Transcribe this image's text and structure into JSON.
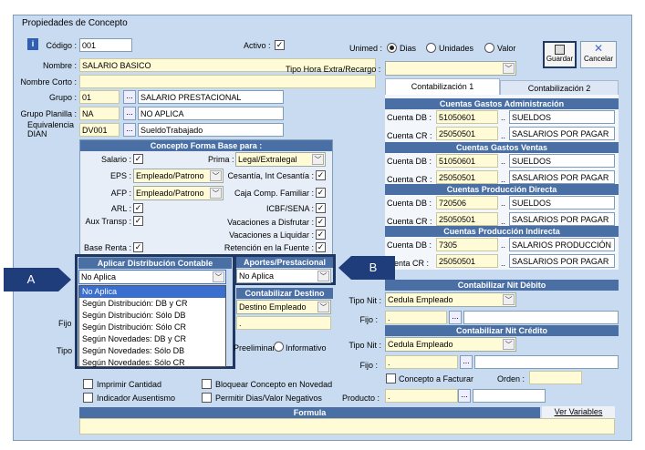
{
  "window": {
    "title": "Propiedades de Concepto"
  },
  "fields": {
    "codigo_label": "Código :",
    "codigo": "001",
    "activo_label": "Activo :",
    "nombre_label": "Nombre :",
    "nombre": "SALARIO BASICO",
    "nombre_corto_label": "Nombre Corto :",
    "grupo_label": "Grupo :",
    "grupo": "01",
    "grupo_desc": "SALARIO PRESTACIONAL",
    "grupo_planilla_label": "Grupo Planilla :",
    "grupo_planilla": "NA",
    "grupo_planilla_desc": "NO APLICA",
    "equivalencia_label": "Equivalencia\nDIAN",
    "equivalencia": "DV001",
    "equivalencia_desc": "SueldoTrabajado",
    "unimed_label": "Unimed :",
    "unimed_options": [
      "Dias",
      "Unidades",
      "Valor"
    ],
    "tipo_hora_label": "Tipo Hora Extra/Recargo :"
  },
  "toolbar": {
    "guardar": "Guardar",
    "cancelar": "Cancelar"
  },
  "forma_base": {
    "header": "Concepto Forma Base para :",
    "salario": "Salario :",
    "prima": "Prima :",
    "prima_value": "Legal/Extralegal",
    "eps": "EPS :",
    "eps_value": "Empleado/Patrono",
    "cesantia": "Cesantía, Int Cesantía :",
    "afp": "AFP :",
    "afp_value": "Empleado/Patrono",
    "caja": "Caja Comp. Familiar :",
    "arl": "ARL :",
    "icbf": "ICBF/SENA :",
    "aux": "Aux Transp :",
    "vac_disfrutar": "Vacaciones a Disfrutar :",
    "vac_liquidar": "Vacaciones a Liquidar :",
    "base_renta": "Base Renta :",
    "retencion": "Retención en la Fuente :"
  },
  "distribucion": {
    "header": "Aplicar Distribución Contable",
    "value": "No Aplica",
    "options": [
      "No Aplica",
      "Según Distribución: DB y CR",
      "Según Distribución: Sólo DB",
      "Según Distribución: Sólo CR",
      "Según Novedades: DB y CR",
      "Según Novedades: Sólo DB",
      "Según Novedades: Sólo CR"
    ]
  },
  "aportes": {
    "header": "Aportes/Prestacional",
    "value": "No Aplica"
  },
  "destino": {
    "header": "Contabilizar Destino",
    "value": "Destino Empleado",
    "fijo_label": "Fijo",
    "tipo_label": "Tipo",
    "preliminar": "Preeliminar",
    "informativo": "Informativo"
  },
  "tabs": [
    "Contabilización 1",
    "Contabilización 2"
  ],
  "cuentas": [
    {
      "header": "Cuentas Gastos Administración",
      "db": "51050601",
      "db_desc": "SUELDOS",
      "cr": "25050501",
      "cr_desc": "SASLARIOS POR PAGAR"
    },
    {
      "header": "Cuentas Gastos Ventas",
      "db": "51050601",
      "db_desc": "SUELDOS",
      "cr": "25050501",
      "cr_desc": "SASLARIOS POR PAGAR"
    },
    {
      "header": "Cuentas Producción Directa",
      "db": "720506",
      "db_desc": "SUELDOS",
      "cr": "25050501",
      "cr_desc": "SASLARIOS POR PAGAR"
    },
    {
      "header": "Cuentas Producción Indirecta",
      "db": "7305",
      "db_desc": "SALARIOS PRODUCCIÓN IN",
      "cr": "25050501",
      "cr_desc": "SASLARIOS POR PAGAR"
    }
  ],
  "cuenta_db_label": "Cuenta DB :",
  "cuenta_cr_label": "Cuenta CR :",
  "cuenta_cr_label_cut": "enta CR :",
  "nit_debito": {
    "header": "Contabilizar Nit Débito",
    "tipo_label": "Tipo Nit :",
    "tipo": "Cedula Empleado",
    "fijo_label": "Fijo :",
    "fijo": "."
  },
  "nit_credito": {
    "header": "Contabilizar Nit Crédito",
    "tipo_label": "Tipo Nit :",
    "tipo": "Cedula Empleado",
    "fijo_label": "Fijo :",
    "fijo": "."
  },
  "bottom": {
    "concepto_facturar": "Concepto a Facturar",
    "orden": "Orden :",
    "producto": "Producto :",
    "producto_value": ".",
    "imprimir": "Imprimir Cantidad",
    "indicador": "Indicador Ausentismo",
    "bloquear": "Bloquear Concepto en Novedad",
    "permitir": "Permitir Dias/Valor Negativos",
    "formula": "Formula",
    "ver_variables": "Ver Variables"
  },
  "callouts": {
    "a": "A",
    "b": "B"
  }
}
